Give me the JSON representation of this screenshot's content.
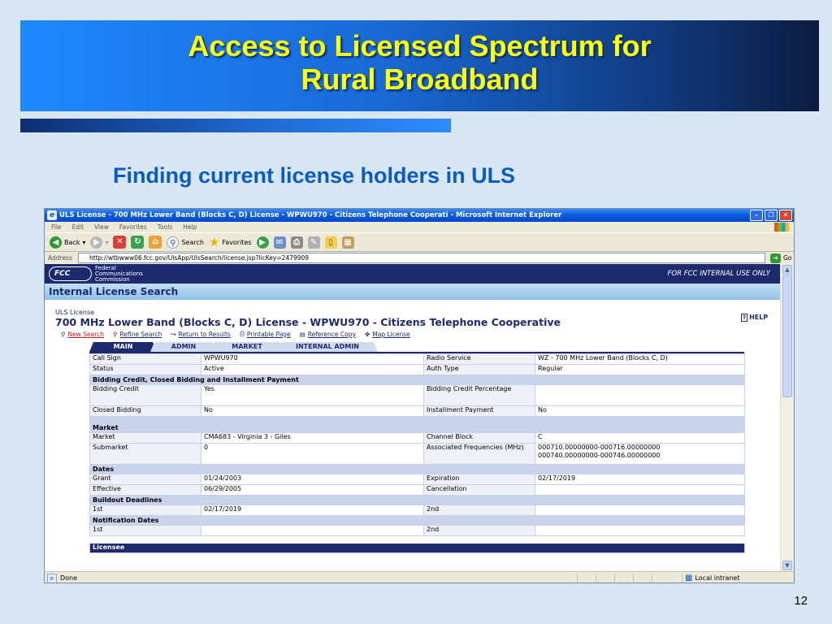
{
  "slide": {
    "title_line1": "Access to Licensed Spectrum for",
    "title_line2": "Rural Broadband",
    "subtitle": "Finding current license holders in ULS",
    "page_number": "12"
  },
  "window": {
    "title": "ULS License - 700 MHz Lower Band (Blocks C, D) License - WPWU970 - Citizens Telephone Cooperati - Microsoft Internet Explorer",
    "menu": [
      "File",
      "Edit",
      "View",
      "Favorites",
      "Tools",
      "Help"
    ],
    "toolbar": {
      "back": "Back",
      "search": "Search",
      "favorites": "Favorites"
    },
    "address_label": "Address",
    "url": "http://wtbwww06.fcc.gov/UlsApp/UlsSearch/license.jsp?licKey=2479909",
    "go": "Go",
    "status": {
      "left": "Done",
      "zone": "Local intranet"
    }
  },
  "page": {
    "fcc": {
      "logo": "FCC",
      "name_lines": [
        "Federal",
        "Communications",
        "Commission"
      ],
      "internal_notice": "FOR FCC INTERNAL USE ONLY"
    },
    "section_title": "Internal License Search",
    "uls_label": "ULS License",
    "license_title": "700 MHz Lower Band (Blocks C, D) License - WPWU970 - Citizens Telephone Cooperative",
    "help": "HELP",
    "actions": [
      "New Search",
      "Refine Search",
      "Return to Results",
      "Printable Page",
      "Reference Copy",
      "Map License"
    ],
    "tabs": [
      "MAIN",
      "ADMIN",
      "MARKET",
      "INTERNAL ADMIN"
    ],
    "fields": {
      "call_sign": {
        "label": "Call Sign",
        "value": "WPWU970"
      },
      "radio_service": {
        "label": "Radio Service",
        "value": "WZ - 700 MHz Lower Band (Blocks C, D)"
      },
      "status": {
        "label": "Status",
        "value": "Active"
      },
      "auth_type": {
        "label": "Auth Type",
        "value": "Regular"
      },
      "bidding_section": "Bidding Credit, Closed Bidding and Installment Payment",
      "bidding_credit": {
        "label": "Bidding Credit",
        "value": "Yes"
      },
      "bidding_credit_pct": {
        "label": "Bidding Credit Percentage",
        "value": ""
      },
      "closed_bidding": {
        "label": "Closed Bidding",
        "value": "No"
      },
      "installment_payment": {
        "label": "Installment Payment",
        "value": "No"
      },
      "market_section": "Market",
      "market": {
        "label": "Market",
        "value": "CMA683 - Virginia 3 - Giles"
      },
      "channel_block": {
        "label": "Channel Block",
        "value": "C"
      },
      "submarket": {
        "label": "Submarket",
        "value": "0"
      },
      "assoc_freq": {
        "label": "Associated Frequencies (MHz)",
        "value1": "000710.00000000-000716.00000000",
        "value2": "000740.00000000-000746.00000000"
      },
      "dates_section": "Dates",
      "grant": {
        "label": "Grant",
        "value": "01/24/2003"
      },
      "expiration": {
        "label": "Expiration",
        "value": "02/17/2019"
      },
      "effective": {
        "label": "Effective",
        "value": "06/29/2005"
      },
      "cancellation": {
        "label": "Cancellation",
        "value": ""
      },
      "buildout_section": "Buildout Deadlines",
      "buildout_1st": {
        "label": "1st",
        "value": "02/17/2019"
      },
      "buildout_2nd": {
        "label": "2nd",
        "value": ""
      },
      "notification_section": "Notification Dates",
      "notification_1st": {
        "label": "1st",
        "value": ""
      },
      "notification_2nd": {
        "label": "2nd",
        "value": ""
      },
      "licensee_section": "Licensee"
    }
  }
}
